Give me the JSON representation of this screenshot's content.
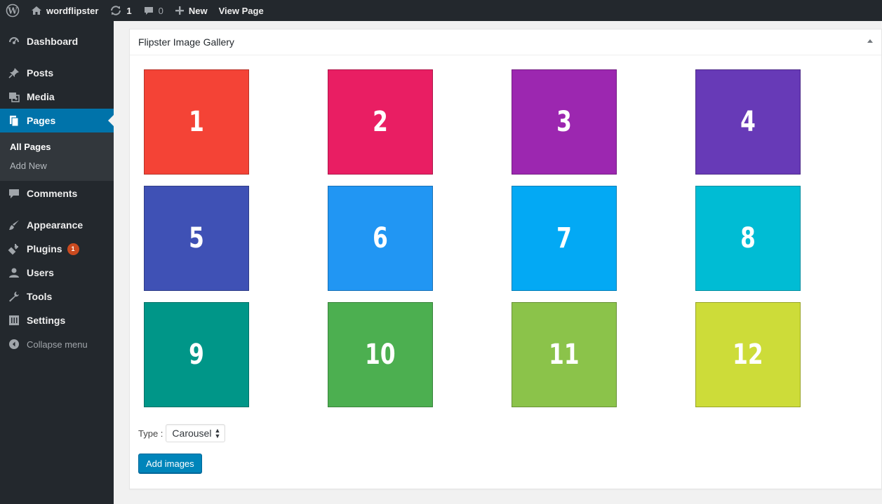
{
  "adminbar": {
    "site_name": "wordflipster",
    "updates_count": "1",
    "comments_count": "0",
    "new_label": "New",
    "view_page_label": "View Page"
  },
  "sidebar": {
    "items": [
      {
        "label": "Dashboard",
        "icon": "dashboard-icon"
      },
      {
        "label": "Posts",
        "icon": "pin-icon"
      },
      {
        "label": "Media",
        "icon": "media-icon"
      },
      {
        "label": "Pages",
        "icon": "pages-icon"
      },
      {
        "label": "Comments",
        "icon": "comments-icon"
      },
      {
        "label": "Appearance",
        "icon": "paintbrush-icon"
      },
      {
        "label": "Plugins",
        "icon": "plugins-icon",
        "badge": "1"
      },
      {
        "label": "Users",
        "icon": "users-icon"
      },
      {
        "label": "Tools",
        "icon": "wrench-icon"
      },
      {
        "label": "Settings",
        "icon": "settings-icon"
      }
    ],
    "pages_submenu": [
      "All Pages",
      "Add New"
    ],
    "collapse_label": "Collapse menu"
  },
  "panel": {
    "title": "Flipster Image Gallery",
    "tiles": [
      {
        "label": "1",
        "color": "#f44336"
      },
      {
        "label": "2",
        "color": "#e91e63"
      },
      {
        "label": "3",
        "color": "#9c27b0"
      },
      {
        "label": "4",
        "color": "#673ab7"
      },
      {
        "label": "5",
        "color": "#3f51b5"
      },
      {
        "label": "6",
        "color": "#2196f3"
      },
      {
        "label": "7",
        "color": "#03a9f4"
      },
      {
        "label": "8",
        "color": "#00bcd4"
      },
      {
        "label": "9",
        "color": "#009688"
      },
      {
        "label": "10",
        "color": "#4caf50"
      },
      {
        "label": "11",
        "color": "#8bc34a"
      },
      {
        "label": "12",
        "color": "#cddc39"
      }
    ],
    "type_label": "Type :",
    "type_value": "Carousel",
    "add_images_label": "Add images"
  }
}
